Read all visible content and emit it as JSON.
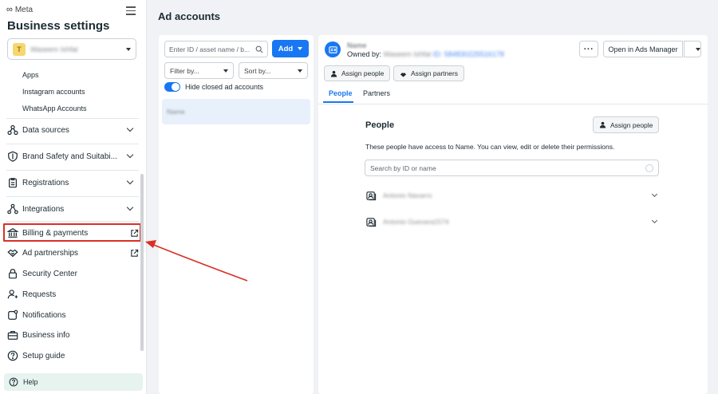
{
  "sidebar": {
    "brand": "Meta",
    "title": "Business settings",
    "account": {
      "initial": "T",
      "name": "Waseem Ishfat"
    },
    "sub_items": [
      "Apps",
      "Instagram accounts",
      "WhatsApp Accounts"
    ],
    "nav": {
      "data_sources": "Data sources",
      "brand_safety": "Brand Safety and Suitabi...",
      "registrations": "Registrations",
      "integrations": "Integrations",
      "billing": "Billing & payments",
      "ad_partnerships": "Ad partnerships",
      "security_center": "Security Center",
      "requests": "Requests",
      "notifications": "Notifications",
      "business_info": "Business info",
      "setup_guide": "Setup guide"
    },
    "help": "Help"
  },
  "main": {
    "page_title": "Ad accounts",
    "list": {
      "search_placeholder": "Enter ID / asset name / b...",
      "add_label": "Add",
      "filter_label": "Filter by...",
      "sort_label": "Sort by...",
      "hide_closed_label": "Hide closed ad accounts",
      "selected_item": "Name"
    },
    "detail": {
      "asset_name": "Name",
      "owned_by_label": "Owned by:",
      "owner_name": "Waseem Ishfat",
      "owner_id": "ID: 584830225516178",
      "more_label": "···",
      "open_ads_manager": "Open in Ads Manager",
      "assign_people": "Assign people",
      "assign_partners": "Assign partners",
      "tabs": {
        "people": "People",
        "partners": "Partners"
      },
      "people_section": {
        "title": "People",
        "assign_button": "Assign people",
        "description": "These people have access to Name. You can view, edit or delete their permissions.",
        "search_placeholder": "Search by ID or name",
        "people": [
          "Antonio Navarro",
          "Antonio Guevara1574"
        ]
      }
    }
  },
  "colors": {
    "accent": "#1877f2",
    "highlight": "#d93025"
  }
}
